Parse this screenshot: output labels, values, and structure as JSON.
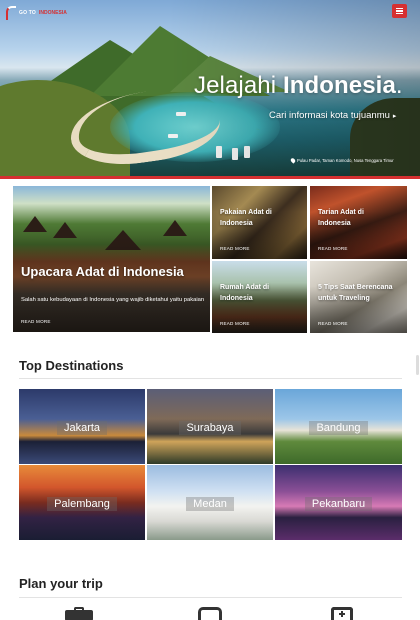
{
  "brand": {
    "part1": "GO TO",
    "part2": "INDONESIA"
  },
  "hero": {
    "title_light": "Jelajahi",
    "title_bold": "Indonesia",
    "title_dot": ".",
    "subtitle": "Cari informasi kota tujuanmu",
    "location": "Pulau Padar, Taman Komodo, Nusa Tenggara Timur"
  },
  "articles": {
    "main": {
      "title": "Upacara Adat di Indonesia",
      "description": "Salah satu kebudayaan di Indonesia yang wajib diketahui yaitu pakaian",
      "more": "READ MORE"
    },
    "items": [
      {
        "title": "Pakaian Adat di Indonesia",
        "more": "READ MORE"
      },
      {
        "title": "Tarian Adat di Indonesia",
        "more": "READ MORE"
      },
      {
        "title": "Rumah Adat di Indonesia",
        "more": "READ MORE"
      },
      {
        "title": "5 Tips Saat Berencana untuk Traveling",
        "more": "READ MORE"
      }
    ]
  },
  "destinations": {
    "heading": "Top Destinations",
    "items": [
      "Jakarta",
      "Surabaya",
      "Bandung",
      "Palembang",
      "Medan",
      "Pekanbaru"
    ]
  },
  "plan": {
    "heading": "Plan your trip",
    "icons": [
      "suitcase-icon",
      "bus-icon",
      "hospital-icon"
    ]
  },
  "colors": {
    "accent": "#d63031"
  }
}
